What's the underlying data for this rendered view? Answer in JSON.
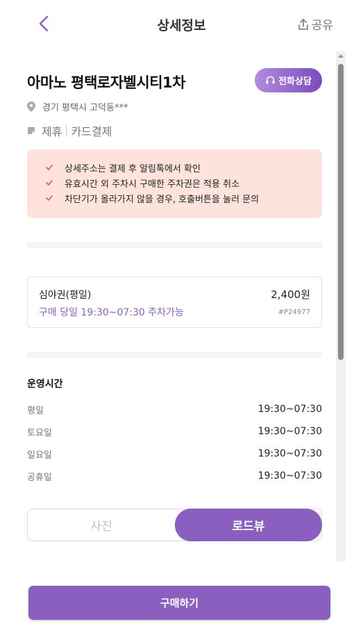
{
  "header": {
    "title": "상세정보",
    "share_label": "공유"
  },
  "lot": {
    "name": "아마노 평택로자벨시티1차",
    "call_label": "전화상담",
    "address": "경기 평택시 고덕동***",
    "tags": [
      "제휴",
      "카드결제"
    ]
  },
  "notice": {
    "items": [
      "상세주소는 결제 후 알림톡에서 확인",
      "유효시간 외 주차시 구매한 주차권은 적용 취소",
      "차단기가 올라가지 않을 경우, 호출버튼을 눌러 문의"
    ]
  },
  "ticket": {
    "name": "심야권(평일)",
    "price": "2,400원",
    "time": "구매 당일 19:30~07:30 주차가능",
    "code": "#P24977"
  },
  "hours": {
    "title": "운영시간",
    "rows": [
      {
        "day": "평일",
        "time": "19:30~07:30"
      },
      {
        "day": "토요일",
        "time": "19:30~07:30"
      },
      {
        "day": "일요일",
        "time": "19:30~07:30"
      },
      {
        "day": "공휴일",
        "time": "19:30~07:30"
      }
    ]
  },
  "view_toggle": {
    "photo_label": "사진",
    "roadview_label": "로드뷰",
    "selected": "로드뷰"
  },
  "footer": {
    "buy_label": "구매하기"
  },
  "colors": {
    "accent": "#8b5fbf",
    "notice_bg": "#fde3dc",
    "check": "#e05a4f"
  }
}
